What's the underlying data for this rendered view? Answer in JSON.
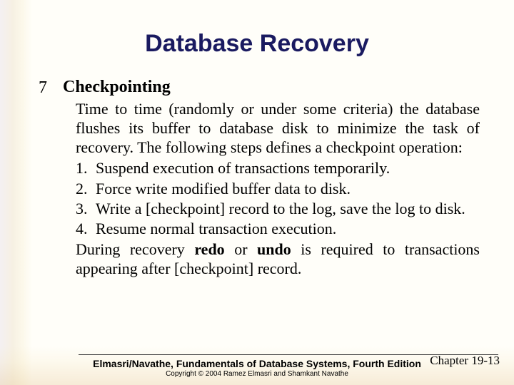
{
  "title": "Database Recovery",
  "section_number": "7",
  "heading": "Checkpointing",
  "intro": "Time to time (randomly or under some criteria) the database flushes its buffer to database disk to minimize the task of recovery.  The following steps defines a checkpoint operation:",
  "steps": [
    {
      "n": "1.",
      "text": "Suspend execution of transactions temporarily."
    },
    {
      "n": "2.",
      "text": "Force write modified buffer data to disk."
    },
    {
      "n": "3.",
      "text": "Write a [checkpoint] record to the log, save the log to disk."
    },
    {
      "n": "4.",
      "text": "Resume normal transaction execution."
    }
  ],
  "outro_pre": "During recovery ",
  "outro_b1": "redo",
  "outro_mid": " or ",
  "outro_b2": "undo",
  "outro_post": " is required to transactions appearing after [checkpoint] record.",
  "footer_main": "Elmasri/Navathe, Fundamentals of Database Systems, Fourth Edition",
  "footer_sub": "Copyright © 2004 Ramez Elmasri and Shamkant Navathe",
  "chapter": "Chapter 19-13"
}
